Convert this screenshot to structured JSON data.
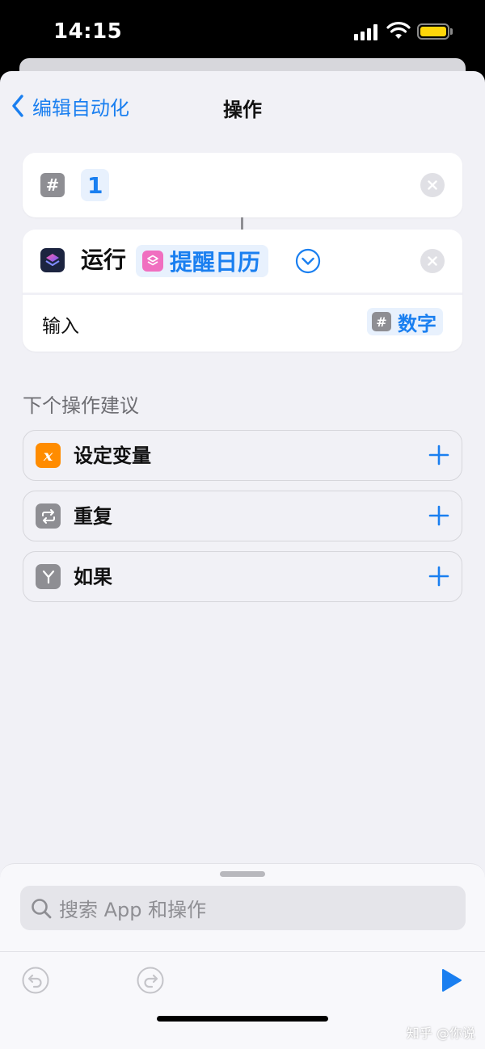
{
  "status_bar": {
    "time": "14:15"
  },
  "nav": {
    "back_label": "编辑自动化",
    "title": "操作"
  },
  "number_action": {
    "icon": "hash-icon",
    "hash_glyph": "#",
    "value": "1"
  },
  "run_action": {
    "label": "运行",
    "shortcut_name": "提醒日历",
    "input_label": "输入",
    "input_value": "数字"
  },
  "suggestions": {
    "header": "下个操作建议",
    "items": [
      {
        "label": "设定变量",
        "icon": "variable-icon",
        "glyph": "x",
        "color": "#ff8c00"
      },
      {
        "label": "重复",
        "icon": "repeat-icon",
        "color": "#8e8e93"
      },
      {
        "label": "如果",
        "icon": "if-branch-icon",
        "color": "#8e8e93"
      }
    ]
  },
  "search": {
    "placeholder": "搜索 App 和操作"
  },
  "watermark": "知乎 @你说",
  "colors": {
    "accent": "#1a7ff0",
    "background": "#f1f1f6",
    "shortcut_pink": "#f06fc0"
  }
}
